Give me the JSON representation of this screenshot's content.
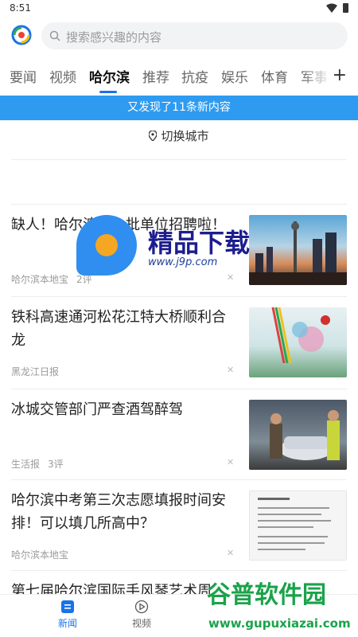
{
  "status": {
    "time": "8:51"
  },
  "search": {
    "placeholder": "搜索感兴趣的内容"
  },
  "tabs": [
    "要闻",
    "视频",
    "哈尔滨",
    "推荐",
    "抗疫",
    "娱乐",
    "体育",
    "军事"
  ],
  "active_tab": "哈尔滨",
  "banner": "又发现了11条新内容",
  "city_switch": "切换城市",
  "news": [
    {
      "title": "缺人！哈尔滨这一批单位招聘啦！",
      "source": "哈尔滨本地宝",
      "comments": "2评",
      "thumb": "city-skyline"
    },
    {
      "title": "铁科高速通河松花江特大桥顺利合龙",
      "source": "黑龙江日报",
      "comments": "",
      "thumb": "bridge-ceremony"
    },
    {
      "title": "冰城交管部门严查酒驾醉驾",
      "source": "生活报",
      "comments": "3评",
      "thumb": "police-check"
    },
    {
      "title": "哈尔滨中考第三次志愿填报时间安排！可以填几所高中？",
      "source": "哈尔滨本地宝",
      "comments": "",
      "thumb": "document"
    },
    {
      "title": "第七届哈尔滨国际手风琴艺术周",
      "source": "",
      "comments": "",
      "thumb": ""
    }
  ],
  "bottom_nav": [
    {
      "label": "新闻",
      "icon": "news-icon"
    },
    {
      "label": "视频",
      "icon": "play-icon"
    }
  ],
  "watermarks": {
    "brand": "精品下载",
    "url": "www.j9p.com",
    "gupu_text": "谷普软件园",
    "gupu_url": "www.gupuxiazai.com"
  },
  "colors": {
    "accent": "#1a73e8",
    "banner": "#2e9bf0"
  }
}
